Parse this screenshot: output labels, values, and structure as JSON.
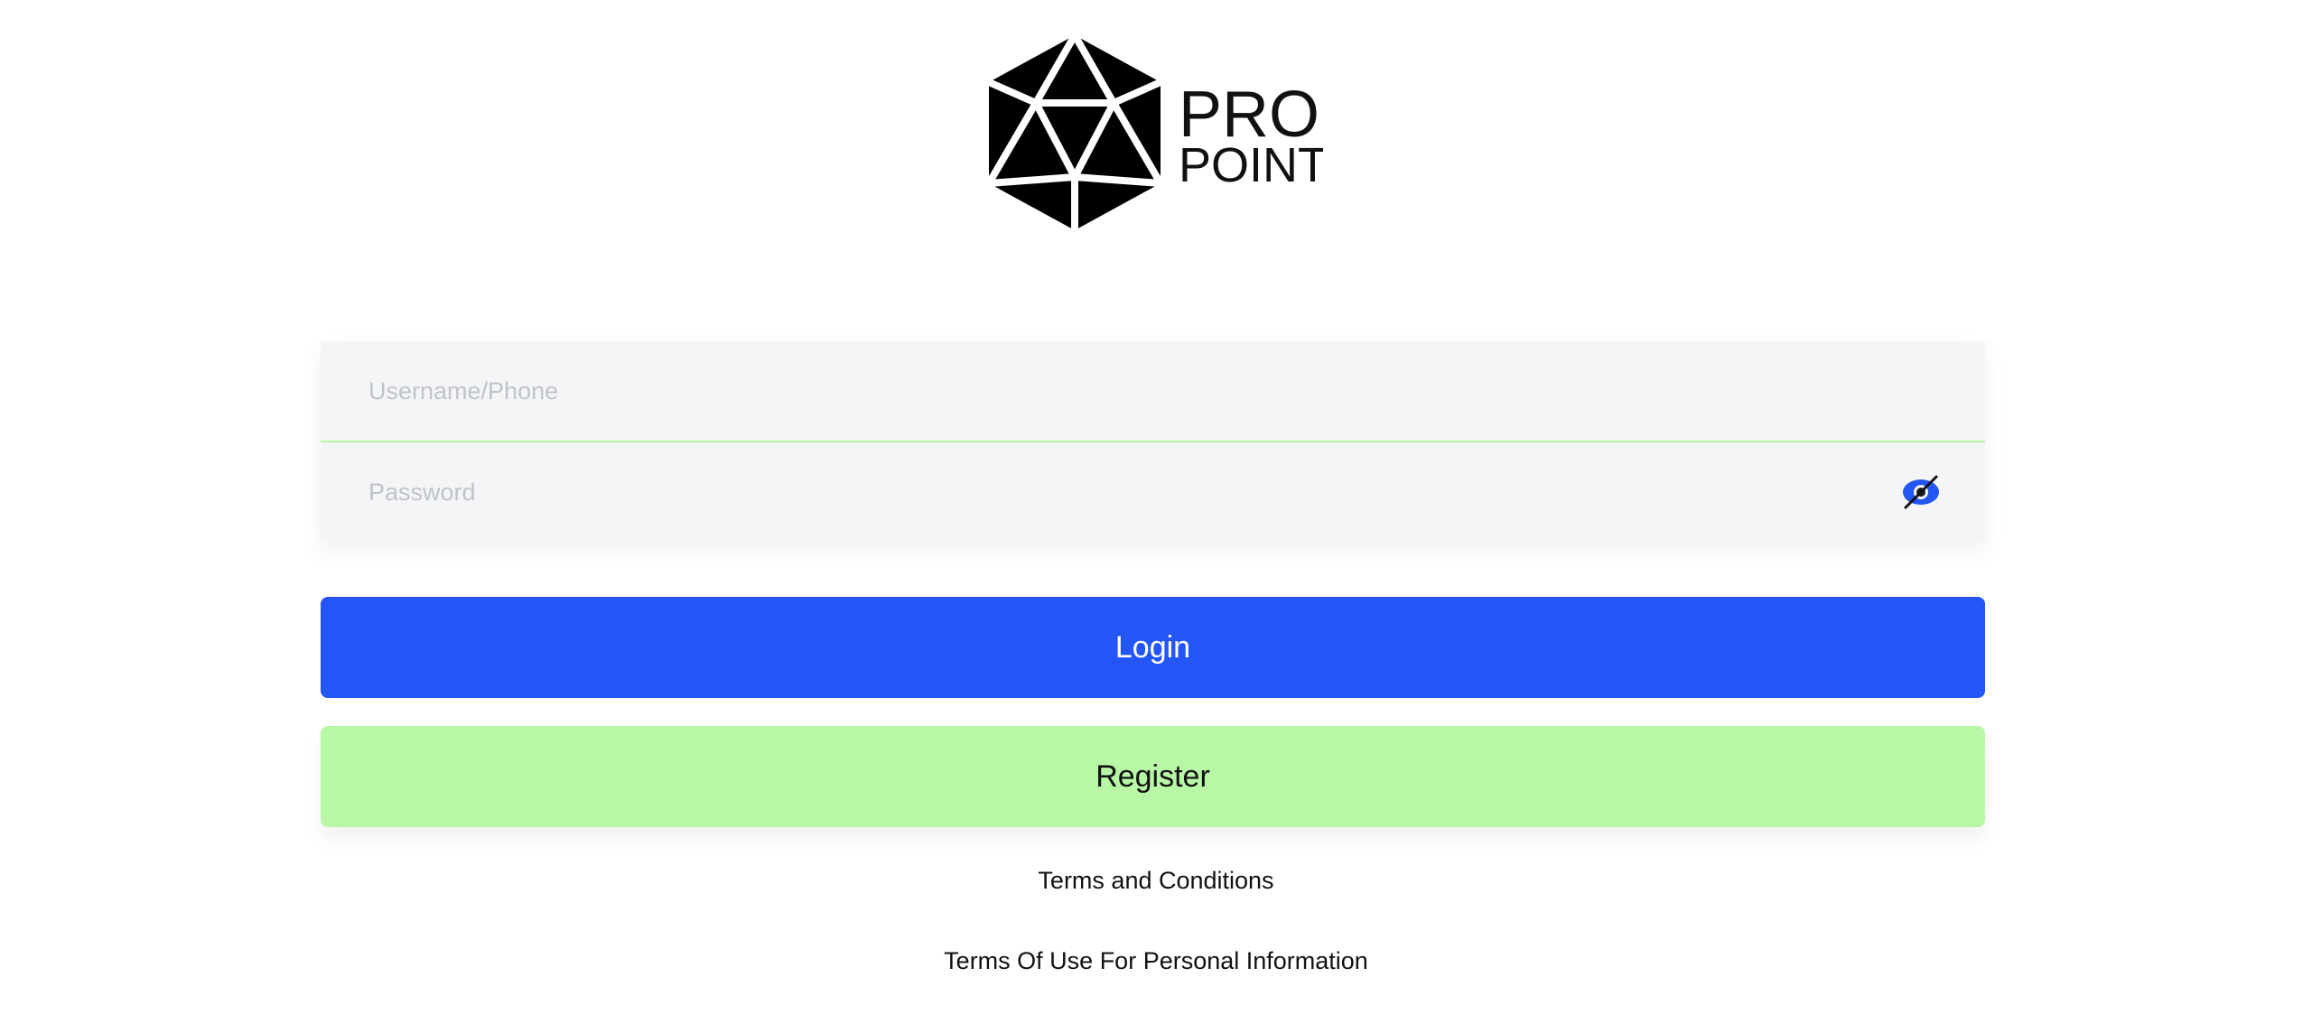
{
  "brand": {
    "logo_line1": "PRO",
    "logo_line2": "POINT",
    "logo_icon": "d20-polyhedron-icon"
  },
  "form": {
    "username_placeholder": "Username/Phone",
    "password_placeholder": "Password",
    "password_toggle_icon": "eye-slash-icon",
    "accent_color": "#2455f6",
    "divider_color": "#b8f6a4"
  },
  "actions": {
    "login_label": "Login",
    "register_label": "Register",
    "login_color": "#2455f6",
    "register_color": "#b8f7a5"
  },
  "links": {
    "terms": "Terms and Conditions",
    "privacy": "Terms Of Use For Personal Information"
  }
}
